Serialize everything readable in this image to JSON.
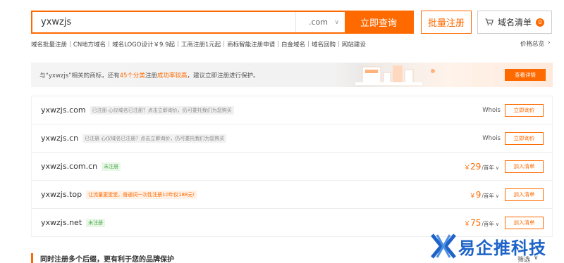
{
  "search": {
    "query": "yxwzjs",
    "tld": ".com",
    "search_label": "立即查询",
    "bulk_label": "批量注册",
    "cart_label": "域名清单",
    "cart_count": "0"
  },
  "links": [
    "域名批量注册",
    "CN地方域名",
    "域名LOGO设计￥9.9起",
    "工商注册1元起",
    "商标智能注册申请",
    "白金域名",
    "域名回购",
    "网站建设"
  ],
  "price_overview": "价格总览",
  "banner": {
    "text_before": "与“yxwzjs”相关的商标，还有",
    "highlight1": "45个分类",
    "text_mid": "注册",
    "highlight2": "成功率较高",
    "text_after": "，建议立即注册进行保护。",
    "button": "查看详情"
  },
  "results": [
    {
      "domain": "yxwzjs.com",
      "tag": "已注册 心仪域名已注册？点击立即询价，仍可委托我们为您购买",
      "tag_style": "gray",
      "whois": "Whois",
      "price": "",
      "unit": "",
      "action": "立即询价"
    },
    {
      "domain": "yxwzjs.cn",
      "tag": "已注册 心仪域名已注册？点击立即询价，仍可委托我们为您购买",
      "tag_style": "gray",
      "whois": "Whois",
      "price": "",
      "unit": "",
      "action": "立即询价"
    },
    {
      "domain": "yxwzjs.com.cn",
      "tag": "未注册",
      "tag_style": "green",
      "whois": "",
      "price": "29",
      "unit": "/首年",
      "action": "加入清单"
    },
    {
      "domain": "yxwzjs.top",
      "tag": "让流量更堂堂，普通词一次性注册10年仅188元!",
      "tag_style": "orange",
      "whois": "",
      "price": "9",
      "unit": "/首年",
      "action": "加入清单"
    },
    {
      "domain": "yxwzjs.net",
      "tag": "未注册",
      "tag_style": "green",
      "whois": "",
      "price": "75",
      "unit": "/首年",
      "action": "加入清单"
    }
  ],
  "currency": "￥",
  "bottom": {
    "title": "同时注册多个后缀，更有利于您的品牌保护",
    "filter": "筛选"
  },
  "watermark": "易企推科技",
  "colors": {
    "accent": "#ff6a00",
    "watermark": "#1e64c8"
  }
}
